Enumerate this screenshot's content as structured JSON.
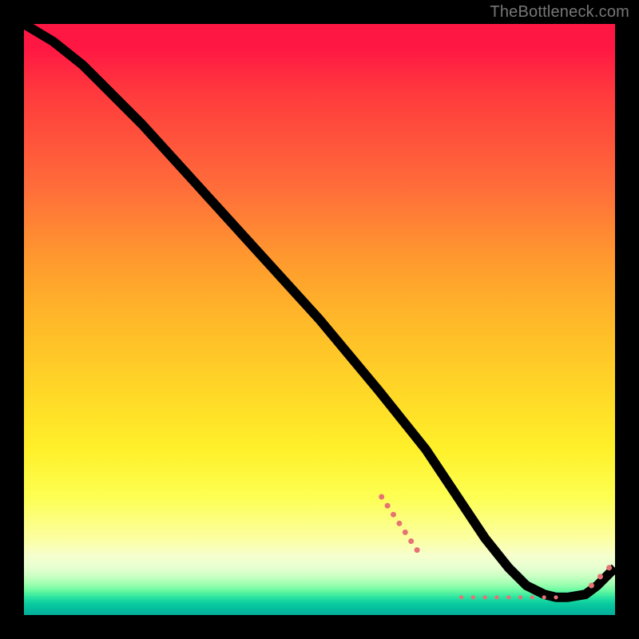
{
  "watermark": "TheBottleneck.com",
  "chart_data": {
    "type": "line",
    "title": "",
    "xlabel": "",
    "ylabel": "",
    "xlim": [
      0,
      100
    ],
    "ylim": [
      0,
      100
    ],
    "curve": {
      "x": [
        0,
        5,
        10,
        20,
        30,
        40,
        50,
        60,
        68,
        74,
        78,
        82,
        85,
        88,
        90,
        92,
        95,
        97,
        100
      ],
      "y": [
        100,
        97,
        93,
        83,
        72,
        61,
        50,
        38,
        28,
        19,
        13,
        8,
        5,
        3.5,
        3,
        3,
        3.5,
        5,
        8
      ]
    },
    "markers": [
      {
        "x": 60.5,
        "y": 20,
        "r": 3.5
      },
      {
        "x": 61.5,
        "y": 18.5,
        "r": 3.5
      },
      {
        "x": 62.5,
        "y": 17,
        "r": 3.5
      },
      {
        "x": 63.5,
        "y": 15.5,
        "r": 3.5
      },
      {
        "x": 64.5,
        "y": 14,
        "r": 3.5
      },
      {
        "x": 65.5,
        "y": 12.5,
        "r": 3.5
      },
      {
        "x": 66.5,
        "y": 11,
        "r": 3.5
      },
      {
        "x": 74,
        "y": 3,
        "r": 2.6
      },
      {
        "x": 76,
        "y": 3,
        "r": 2.6
      },
      {
        "x": 78,
        "y": 3,
        "r": 2.6
      },
      {
        "x": 80,
        "y": 3,
        "r": 2.6
      },
      {
        "x": 82,
        "y": 3,
        "r": 2.6
      },
      {
        "x": 84,
        "y": 3,
        "r": 2.6
      },
      {
        "x": 86,
        "y": 3,
        "r": 2.6
      },
      {
        "x": 88,
        "y": 3,
        "r": 2.6
      },
      {
        "x": 90,
        "y": 3,
        "r": 2.6
      },
      {
        "x": 96,
        "y": 5,
        "r": 3.5
      },
      {
        "x": 97.5,
        "y": 6.5,
        "r": 3.5
      },
      {
        "x": 99,
        "y": 8,
        "r": 3.5
      }
    ]
  }
}
